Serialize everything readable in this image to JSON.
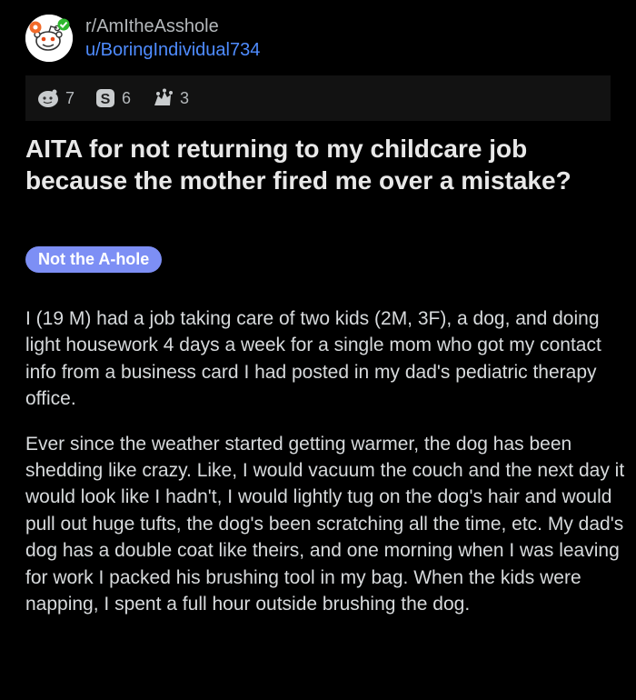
{
  "post": {
    "subreddit": "r/AmItheAsshole",
    "author": "u/BoringIndividual734",
    "avatar_icon": "reddit-snoo-avatar-icon",
    "awards": [
      {
        "icon": "silver-award-icon",
        "count": "7"
      },
      {
        "icon": "gold-award-icon",
        "count": "6"
      },
      {
        "icon": "helpful-award-icon",
        "count": "3"
      }
    ],
    "title": "AITA for not returning to my childcare job because the mother fired me over a mistake?",
    "flair": "Not the A-hole",
    "paragraphs": [
      "I (19 M) had a job taking care of two kids (2M, 3F), a dog, and doing light housework 4 days a week for a single mom who got my contact info from a business card I had posted in my dad's pediatric therapy office.",
      "Ever since the weather started getting warmer, the dog has been shedding like crazy. Like, I would vacuum the couch and the next day it would look like I hadn't, I would lightly tug on the dog's hair and would pull out huge tufts, the dog's been scratching all the time, etc. My dad's dog has a double coat like theirs, and one morning when I was leaving for work I packed his brushing tool in my bag. When the kids were napping, I spent a full hour outside brushing the dog."
    ]
  },
  "colors": {
    "background": "#000000",
    "link": "#4f8cff",
    "flair_bg": "#7d8ff5",
    "awards_bar_bg": "#121212",
    "text": "#d7dadc"
  }
}
